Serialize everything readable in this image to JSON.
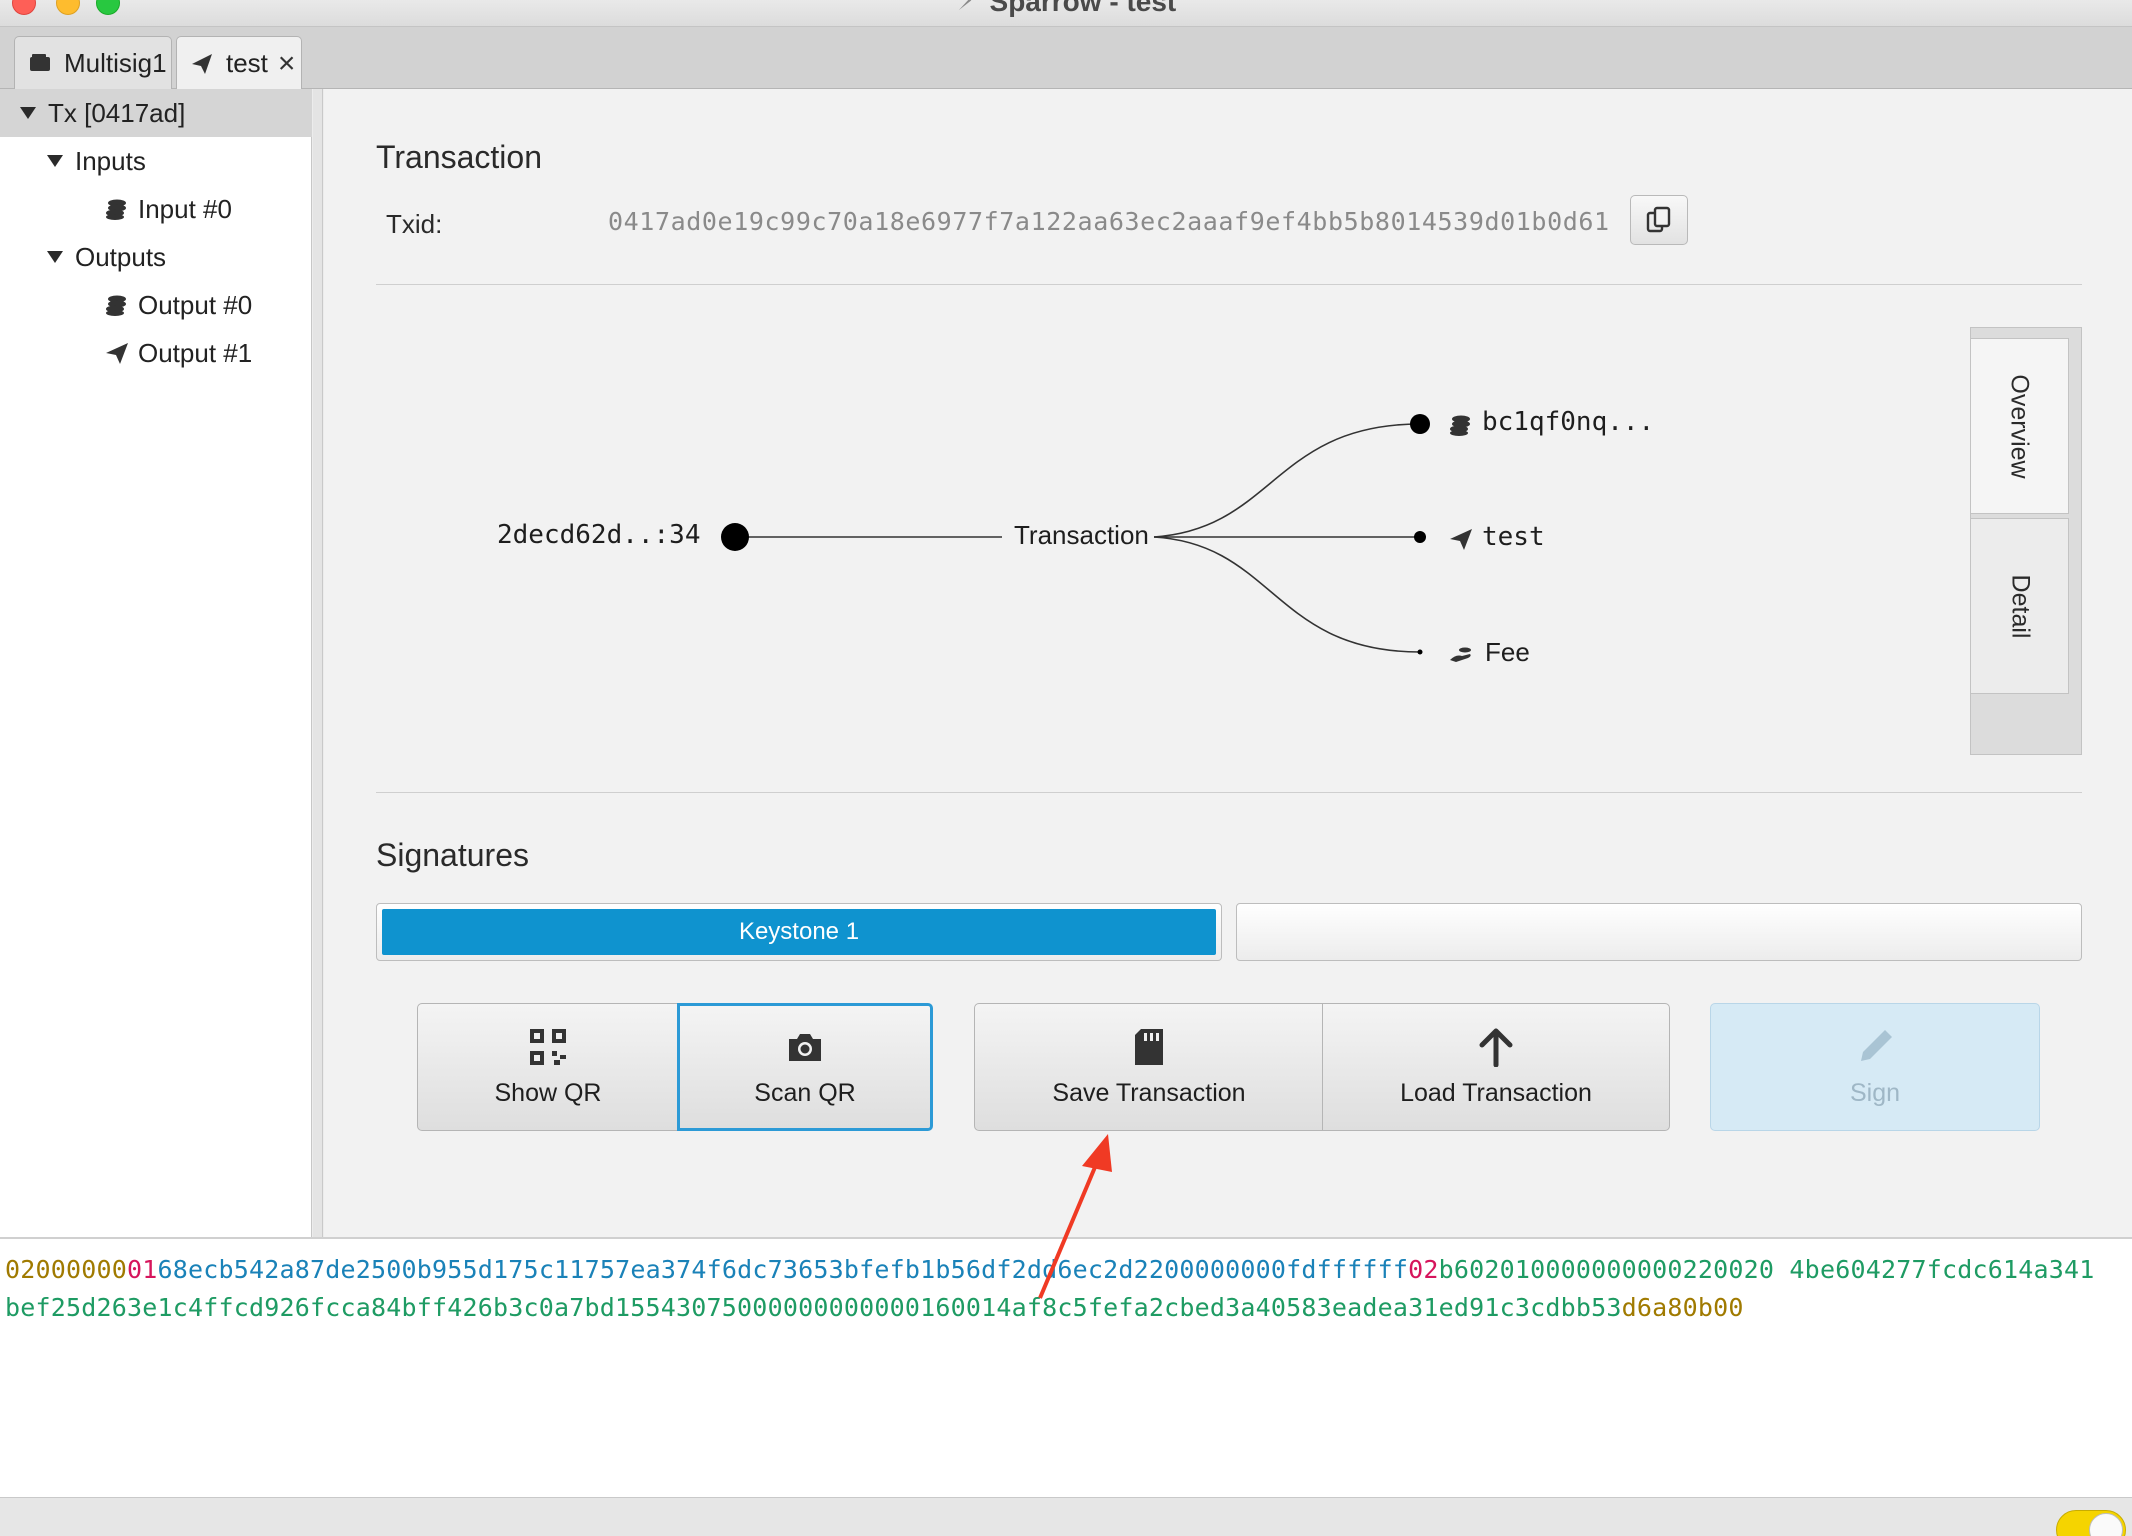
{
  "window": {
    "title": "Sparrow - test"
  },
  "tabs": [
    {
      "label": "Multisig1",
      "icon": "wallet-icon"
    },
    {
      "label": "test",
      "icon": "send-icon",
      "closable": true
    }
  ],
  "tree": {
    "root": "Tx [0417ad]",
    "inputs_label": "Inputs",
    "inputs": [
      "Input #0"
    ],
    "outputs_label": "Outputs",
    "outputs": [
      "Output #0",
      "Output #1"
    ]
  },
  "transaction": {
    "section_title": "Transaction",
    "txid_label": "Txid:",
    "txid": "0417ad0e19c99c70a18e6977f7a122aa63ec2aaaf9ef4bb5b8014539d01b0d61"
  },
  "diagram": {
    "input_label": "2decd62d..:34",
    "center_label": "Transaction",
    "outputs": [
      {
        "label": "bc1qf0nq...",
        "icon": "coins-icon"
      },
      {
        "label": "test",
        "icon": "send-icon"
      },
      {
        "label": "Fee",
        "icon": "hand-coin-icon"
      }
    ]
  },
  "view_tabs": {
    "overview": "Overview",
    "detail": "Detail"
  },
  "signatures": {
    "section_title": "Signatures",
    "signers": [
      {
        "label": "Keystone 1",
        "signed": true
      },
      {
        "label": "",
        "signed": false
      }
    ]
  },
  "actions": {
    "show_qr": "Show QR",
    "scan_qr": "Scan QR",
    "save_transaction": "Save Transaction",
    "load_transaction": "Load Transaction",
    "sign": "Sign"
  },
  "hex": {
    "line1": [
      {
        "text": "02000000",
        "kind": "version"
      },
      {
        "text": "01",
        "kind": "count"
      },
      {
        "text": "68ecb542a87de2500b955d175c11757ea374f6dc73653bfefb1b56df2dd6ec2d2200000000fdffffff",
        "kind": "input"
      },
      {
        "text": "02",
        "kind": "count"
      },
      {
        "text": "b602010000000000220020 4be604277fcdc614a341",
        "kind": "output"
      }
    ],
    "line2": [
      {
        "text": "bef25d263e1c4ffcd926fcca84bff426b3c0a7bd15543075000000000000160014af8c5fefa2cbed3a40583eadea31ed91c3cdbb53",
        "kind": "output"
      },
      {
        "text": "d6a80b00",
        "kind": "lock"
      }
    ]
  },
  "colors": {
    "accent": "#0f93cf",
    "annotation_arrow": "#f03a24",
    "hex_version": "#a07a00",
    "hex_count": "#d6155c",
    "hex_input": "#1a82b8",
    "hex_output": "#1e9b63"
  }
}
